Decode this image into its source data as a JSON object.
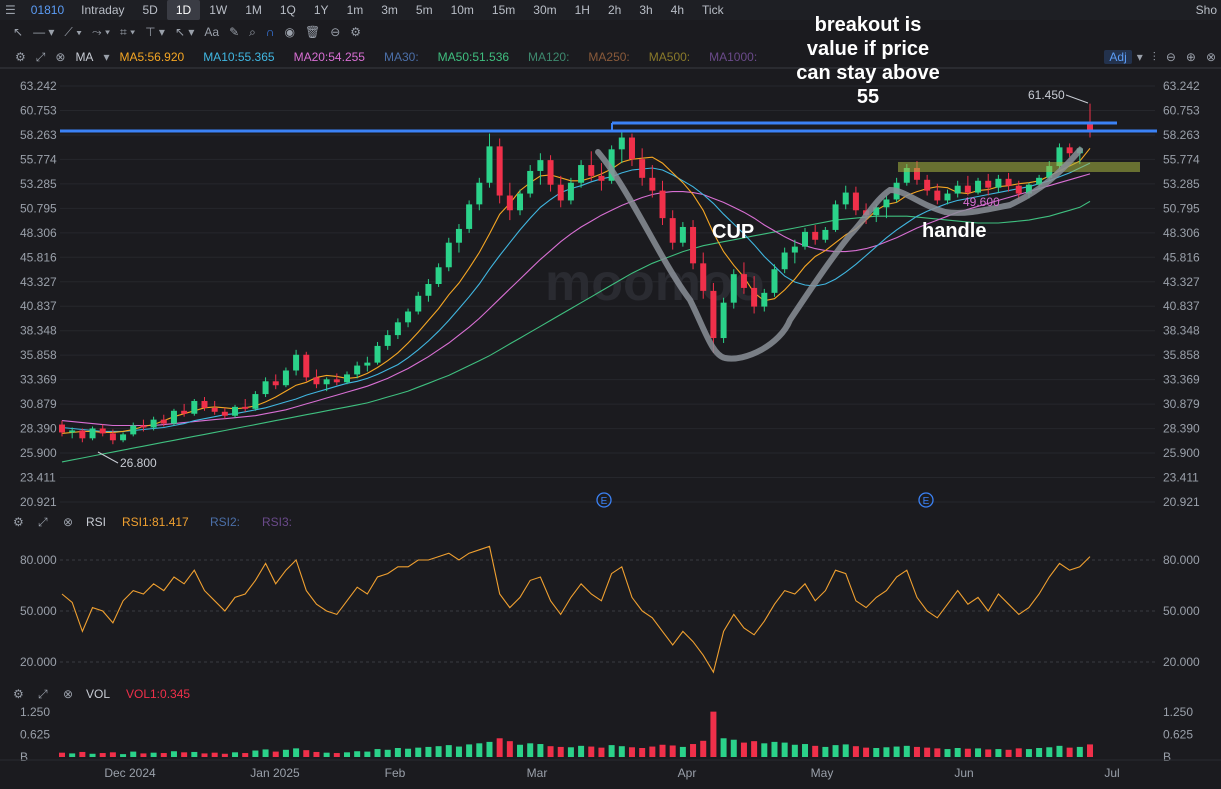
{
  "topbar": {
    "symbol": "01810",
    "timeframes": [
      "Intraday",
      "5D",
      "1D",
      "1W",
      "1M",
      "1Q",
      "1Y",
      "1m",
      "3m",
      "5m",
      "10m",
      "15m",
      "30m",
      "1H",
      "2h",
      "3h",
      "4h",
      "Tick"
    ],
    "active_timeframe": "1D",
    "right_label": "Sho"
  },
  "toolbar": {
    "icons": [
      "cursor-icon",
      "line-icon",
      "trend-icon",
      "path-icon",
      "pattern-icon",
      "measure-icon",
      "arrow-icon",
      "text-icon",
      "pen-icon",
      "zoom-icon",
      "magnet-icon",
      "eye-icon",
      "trash-icon",
      "link-icon",
      "settings-icon"
    ],
    "text_tool": "Aa"
  },
  "ma_bar": {
    "label": "MA",
    "items": [
      {
        "text": "MA5:56.920",
        "color": "#f5a623"
      },
      {
        "text": "MA10:55.365",
        "color": "#40b6e0"
      },
      {
        "text": "MA20:54.255",
        "color": "#d86fd3"
      },
      {
        "text": "MA30:",
        "color": "#4b6fa8"
      },
      {
        "text": "MA50:51.536",
        "color": "#3fbf7f"
      },
      {
        "text": "MA120:",
        "color": "#3e8a6f"
      },
      {
        "text": "MA250:",
        "color": "#8a5a3a"
      },
      {
        "text": "MA500:",
        "color": "#8a7a2a"
      },
      {
        "text": "MA1000:",
        "color": "#6a4a8a"
      }
    ],
    "adj": "Adj"
  },
  "price_axis": {
    "ticks": [
      "63.242",
      "60.753",
      "58.263",
      "55.774",
      "53.285",
      "50.795",
      "48.306",
      "45.816",
      "43.327",
      "40.837",
      "38.348",
      "35.858",
      "33.369",
      "30.879",
      "28.390",
      "25.900",
      "23.411",
      "20.921"
    ]
  },
  "annotations": {
    "breakout": [
      "breakout is",
      "value if price",
      "can stay above",
      "55"
    ],
    "cup": "CUP",
    "handle": "handle",
    "high_label": "61.450",
    "low_label": "26.800",
    "handle_low": "49.600",
    "watermark": "moomoo",
    "event_marker": "E"
  },
  "rsi_bar": {
    "label": "RSI",
    "rsi1": "RSI1:81.417",
    "rsi2": "RSI2:",
    "rsi3": "RSI3:",
    "ticks": [
      "80.000",
      "50.000",
      "20.000"
    ]
  },
  "vol_bar": {
    "label": "VOL",
    "vol1": "VOL1:0.345",
    "ticks": [
      "1.250",
      "0.625",
      "B"
    ],
    "unit": "B"
  },
  "date_axis": [
    "Dec 2024",
    "Jan 2025",
    "Feb",
    "Mar",
    "Apr",
    "May",
    "Jun",
    "Jul"
  ],
  "colors": {
    "up": "#2bd28a",
    "down": "#f0304a",
    "ma5": "#f5a623",
    "ma10": "#40b6e0",
    "ma20": "#d86fd3",
    "ma50": "#3fbf7f",
    "rsi": "#f0a030",
    "level": "#3b82f6"
  },
  "chart_data": {
    "type": "candlestick",
    "ylim": [
      20.921,
      63.242
    ],
    "ohlc": [
      [
        28.8,
        29.2,
        27.6,
        28.0
      ],
      [
        28.0,
        28.5,
        27.4,
        28.2
      ],
      [
        28.2,
        28.4,
        27.0,
        27.4
      ],
      [
        27.4,
        28.6,
        27.2,
        28.4
      ],
      [
        28.4,
        28.8,
        27.6,
        27.9
      ],
      [
        27.9,
        28.3,
        26.8,
        27.2
      ],
      [
        27.2,
        28.0,
        27.0,
        27.8
      ],
      [
        27.8,
        29.0,
        27.6,
        28.7
      ],
      [
        28.7,
        29.3,
        28.1,
        28.5
      ],
      [
        28.5,
        29.6,
        28.2,
        29.3
      ],
      [
        29.3,
        29.8,
        28.6,
        28.9
      ],
      [
        28.9,
        30.4,
        28.7,
        30.2
      ],
      [
        30.2,
        30.9,
        29.6,
        29.9
      ],
      [
        29.9,
        31.4,
        29.7,
        31.2
      ],
      [
        31.2,
        31.6,
        30.2,
        30.5
      ],
      [
        30.5,
        31.2,
        29.8,
        30.1
      ],
      [
        30.1,
        30.5,
        29.4,
        29.7
      ],
      [
        29.7,
        30.8,
        29.5,
        30.6
      ],
      [
        30.6,
        31.4,
        30.1,
        30.4
      ],
      [
        30.4,
        32.2,
        30.2,
        31.9
      ],
      [
        31.9,
        33.6,
        31.6,
        33.2
      ],
      [
        33.2,
        33.9,
        32.4,
        32.8
      ],
      [
        32.8,
        34.6,
        32.6,
        34.3
      ],
      [
        34.3,
        36.4,
        33.8,
        35.9
      ],
      [
        35.9,
        36.2,
        33.2,
        33.6
      ],
      [
        33.6,
        34.4,
        32.5,
        32.9
      ],
      [
        32.9,
        33.6,
        32.2,
        33.4
      ],
      [
        33.4,
        34.0,
        32.8,
        33.1
      ],
      [
        33.1,
        34.2,
        32.9,
        33.9
      ],
      [
        33.9,
        35.2,
        33.5,
        34.8
      ],
      [
        34.8,
        35.7,
        34.2,
        35.1
      ],
      [
        35.1,
        37.2,
        34.9,
        36.8
      ],
      [
        36.8,
        38.4,
        36.4,
        37.9
      ],
      [
        37.9,
        39.6,
        37.5,
        39.2
      ],
      [
        39.2,
        40.6,
        38.7,
        40.3
      ],
      [
        40.3,
        42.3,
        40.0,
        41.9
      ],
      [
        41.9,
        43.6,
        41.3,
        43.1
      ],
      [
        43.1,
        45.2,
        42.8,
        44.8
      ],
      [
        44.8,
        47.8,
        44.4,
        47.3
      ],
      [
        47.3,
        49.2,
        46.3,
        48.7
      ],
      [
        48.7,
        51.6,
        48.3,
        51.2
      ],
      [
        51.2,
        53.9,
        50.6,
        53.4
      ],
      [
        53.4,
        58.4,
        52.9,
        57.1
      ],
      [
        57.1,
        57.9,
        51.3,
        52.1
      ],
      [
        52.1,
        53.4,
        49.6,
        50.6
      ],
      [
        50.6,
        52.7,
        50.1,
        52.3
      ],
      [
        52.3,
        55.2,
        51.9,
        54.6
      ],
      [
        54.6,
        56.4,
        53.2,
        55.7
      ],
      [
        55.7,
        56.2,
        52.5,
        53.2
      ],
      [
        53.2,
        54.1,
        50.9,
        51.6
      ],
      [
        51.6,
        53.9,
        51.2,
        53.4
      ],
      [
        53.4,
        55.7,
        52.9,
        55.2
      ],
      [
        55.2,
        56.6,
        53.6,
        54.1
      ],
      [
        54.1,
        55.4,
        52.6,
        53.6
      ],
      [
        53.6,
        57.2,
        53.3,
        56.8
      ],
      [
        56.8,
        58.6,
        55.4,
        58.0
      ],
      [
        58.0,
        58.4,
        55.1,
        55.8
      ],
      [
        55.8,
        56.9,
        53.1,
        53.9
      ],
      [
        53.9,
        55.2,
        51.9,
        52.6
      ],
      [
        52.6,
        53.6,
        49.1,
        49.8
      ],
      [
        49.8,
        50.6,
        46.6,
        47.3
      ],
      [
        47.3,
        49.4,
        46.9,
        48.9
      ],
      [
        48.9,
        49.6,
        44.6,
        45.2
      ],
      [
        45.2,
        46.3,
        41.6,
        42.4
      ],
      [
        42.4,
        43.2,
        36.1,
        37.6
      ],
      [
        37.6,
        41.7,
        37.1,
        41.2
      ],
      [
        41.2,
        44.6,
        40.6,
        44.1
      ],
      [
        44.1,
        45.3,
        42.1,
        42.7
      ],
      [
        42.7,
        43.9,
        40.1,
        40.8
      ],
      [
        40.8,
        42.6,
        40.3,
        42.2
      ],
      [
        42.2,
        45.1,
        41.8,
        44.6
      ],
      [
        44.6,
        46.8,
        44.2,
        46.3
      ],
      [
        46.3,
        47.6,
        45.2,
        46.9
      ],
      [
        46.9,
        48.8,
        46.6,
        48.4
      ],
      [
        48.4,
        49.1,
        47.1,
        47.6
      ],
      [
        47.6,
        48.9,
        47.3,
        48.6
      ],
      [
        48.6,
        51.6,
        48.4,
        51.2
      ],
      [
        51.2,
        53.1,
        50.7,
        52.4
      ],
      [
        52.4,
        53.0,
        50.1,
        50.6
      ],
      [
        50.6,
        51.3,
        49.2,
        50.1
      ],
      [
        50.1,
        51.2,
        49.4,
        50.9
      ],
      [
        50.9,
        52.1,
        49.8,
        51.7
      ],
      [
        51.7,
        53.9,
        51.4,
        53.4
      ],
      [
        53.4,
        55.3,
        53.1,
        54.9
      ],
      [
        54.9,
        55.6,
        53.2,
        53.7
      ],
      [
        53.7,
        54.2,
        52.1,
        52.6
      ],
      [
        52.6,
        53.3,
        51.2,
        51.6
      ],
      [
        51.6,
        52.7,
        51.2,
        52.3
      ],
      [
        52.3,
        53.6,
        51.9,
        53.1
      ],
      [
        53.1,
        54.1,
        52.1,
        52.4
      ],
      [
        52.4,
        53.9,
        52.2,
        53.6
      ],
      [
        53.6,
        54.3,
        52.1,
        52.9
      ],
      [
        52.9,
        54.2,
        52.4,
        53.8
      ],
      [
        53.8,
        54.4,
        52.5,
        53.1
      ],
      [
        53.1,
        53.6,
        51.7,
        52.3
      ],
      [
        52.3,
        53.4,
        51.8,
        53.2
      ],
      [
        53.2,
        54.2,
        52.7,
        53.9
      ],
      [
        53.9,
        55.6,
        53.6,
        55.1
      ],
      [
        55.1,
        57.4,
        54.8,
        57.0
      ],
      [
        57.0,
        57.4,
        56.0,
        56.4
      ],
      [
        56.4,
        57.1,
        55.3,
        56.9
      ],
      [
        59.6,
        61.45,
        58.0,
        58.6
      ]
    ],
    "volume": [
      0.12,
      0.1,
      0.14,
      0.09,
      0.11,
      0.13,
      0.08,
      0.15,
      0.1,
      0.12,
      0.11,
      0.16,
      0.13,
      0.14,
      0.1,
      0.12,
      0.09,
      0.13,
      0.11,
      0.18,
      0.21,
      0.15,
      0.2,
      0.24,
      0.19,
      0.14,
      0.12,
      0.11,
      0.13,
      0.16,
      0.15,
      0.22,
      0.2,
      0.25,
      0.23,
      0.26,
      0.28,
      0.3,
      0.33,
      0.29,
      0.35,
      0.38,
      0.42,
      0.52,
      0.44,
      0.34,
      0.38,
      0.36,
      0.3,
      0.28,
      0.27,
      0.31,
      0.29,
      0.26,
      0.33,
      0.3,
      0.27,
      0.25,
      0.29,
      0.34,
      0.32,
      0.28,
      0.36,
      0.45,
      1.26,
      0.52,
      0.48,
      0.4,
      0.44,
      0.38,
      0.42,
      0.4,
      0.34,
      0.36,
      0.31,
      0.28,
      0.33,
      0.35,
      0.3,
      0.26,
      0.25,
      0.27,
      0.29,
      0.31,
      0.28,
      0.26,
      0.24,
      0.22,
      0.25,
      0.23,
      0.24,
      0.21,
      0.22,
      0.2,
      0.24,
      0.22,
      0.25,
      0.27,
      0.31,
      0.26,
      0.28,
      0.35
    ],
    "rsi": [
      60,
      55,
      38,
      52,
      50,
      43,
      56,
      62,
      60,
      66,
      62,
      70,
      66,
      74,
      62,
      56,
      50,
      58,
      60,
      68,
      78,
      66,
      74,
      80,
      62,
      54,
      50,
      48,
      56,
      64,
      60,
      70,
      72,
      76,
      76,
      80,
      80,
      82,
      84,
      80,
      84,
      86,
      88,
      60,
      52,
      58,
      68,
      70,
      56,
      48,
      58,
      66,
      60,
      56,
      72,
      76,
      58,
      50,
      46,
      38,
      30,
      38,
      32,
      24,
      14,
      38,
      48,
      40,
      36,
      44,
      54,
      62,
      60,
      66,
      56,
      62,
      74,
      72,
      56,
      52,
      58,
      62,
      70,
      74,
      58,
      50,
      46,
      54,
      62,
      54,
      58,
      50,
      60,
      54,
      48,
      52,
      60,
      70,
      78,
      74,
      76,
      82
    ],
    "ma5": [
      27.9,
      28.0,
      28.1,
      28.1,
      28.0,
      28.0,
      28.1,
      28.3,
      28.6,
      28.8,
      29.2,
      29.6,
      29.9,
      30.2,
      30.5,
      30.6,
      30.5,
      30.4,
      30.5,
      30.7,
      31.1,
      31.6,
      32.2,
      32.8,
      33.1,
      33.6,
      33.8,
      33.7,
      33.5,
      33.6,
      34.0,
      34.6,
      35.3,
      36.1,
      37.1,
      38.2,
      39.4,
      40.6,
      42.0,
      43.2,
      44.7,
      46.3,
      48.2,
      50.2,
      51.3,
      52.6,
      53.4,
      54.1,
      54.2,
      53.9,
      53.6,
      53.6,
      53.9,
      54.3,
      54.8,
      55.5,
      55.8,
      55.9,
      56.0,
      55.4,
      54.4,
      53.4,
      52.2,
      50.6,
      48.3,
      46.4,
      45.0,
      43.8,
      42.2,
      41.4,
      41.6,
      42.5,
      43.6,
      44.9,
      45.9,
      46.5,
      47.3,
      48.1,
      48.7,
      49.6,
      50.6,
      51.2,
      51.4,
      52.1,
      52.5,
      52.8,
      53.0,
      52.9,
      52.4,
      52.3,
      52.6,
      52.7,
      53.0,
      53.1,
      53.3,
      53.4,
      53.6,
      54.1,
      54.6,
      55.1,
      55.6,
      56.9
    ],
    "ma10": [
      28.5,
      28.4,
      28.3,
      28.2,
      28.1,
      28.1,
      28.1,
      28.2,
      28.3,
      28.4,
      28.5,
      28.7,
      28.9,
      29.2,
      29.4,
      29.6,
      29.8,
      29.9,
      30.1,
      30.3,
      30.5,
      30.8,
      31.1,
      31.4,
      31.8,
      32.1,
      32.4,
      32.7,
      33.0,
      33.2,
      33.5,
      33.9,
      34.4,
      34.9,
      35.6,
      36.4,
      37.3,
      38.3,
      39.4,
      40.6,
      41.8,
      43.1,
      44.6,
      46.0,
      47.3,
      48.6,
      49.8,
      50.9,
      51.7,
      52.4,
      52.8,
      53.1,
      53.5,
      53.8,
      54.0,
      54.4,
      54.7,
      54.8,
      54.9,
      54.7,
      54.2,
      53.6,
      53.0,
      52.2,
      51.3,
      50.2,
      49.2,
      48.2,
      47.1,
      45.9,
      44.9,
      43.9,
      43.3,
      43.0,
      42.9,
      43.1,
      43.6,
      44.3,
      45.1,
      46.0,
      46.9,
      47.8,
      48.6,
      49.3,
      50.0,
      50.5,
      50.9,
      51.3,
      51.6,
      51.8,
      52.0,
      52.2,
      52.4,
      52.6,
      52.8,
      53.0,
      53.3,
      53.6,
      54.0,
      54.4,
      54.9,
      55.4
    ],
    "ma20": [
      29.2,
      29.1,
      29.0,
      28.9,
      28.8,
      28.7,
      28.7,
      28.7,
      28.7,
      28.7,
      28.8,
      28.9,
      29.0,
      29.1,
      29.2,
      29.3,
      29.4,
      29.5,
      29.6,
      29.7,
      29.9,
      30.1,
      30.3,
      30.6,
      30.9,
      31.2,
      31.5,
      31.8,
      32.1,
      32.4,
      32.7,
      33.1,
      33.5,
      34.0,
      34.5,
      35.1,
      35.7,
      36.4,
      37.1,
      37.9,
      38.7,
      39.6,
      40.6,
      41.6,
      42.6,
      43.6,
      44.6,
      45.6,
      46.5,
      47.4,
      48.2,
      48.9,
      49.5,
      50.1,
      50.6,
      51.1,
      51.5,
      51.9,
      52.2,
      52.4,
      52.5,
      52.5,
      52.4,
      52.2,
      51.8,
      51.4,
      50.9,
      50.4,
      49.8,
      49.1,
      48.5,
      47.9,
      47.4,
      47.0,
      46.7,
      46.5,
      46.4,
      46.4,
      46.5,
      46.7,
      47.0,
      47.4,
      47.8,
      48.3,
      48.8,
      49.2,
      49.6,
      50.0,
      50.4,
      50.7,
      51.0,
      51.3,
      51.6,
      51.9,
      52.2,
      52.5,
      52.8,
      53.1,
      53.4,
      53.7,
      54.0,
      54.3
    ],
    "ma50": [
      25.0,
      25.2,
      25.4,
      25.6,
      25.8,
      26.0,
      26.2,
      26.4,
      26.6,
      26.8,
      27.0,
      27.2,
      27.4,
      27.6,
      27.8,
      28.0,
      28.2,
      28.4,
      28.6,
      28.8,
      29.0,
      29.2,
      29.4,
      29.6,
      29.8,
      30.0,
      30.2,
      30.4,
      30.6,
      30.8,
      31.0,
      31.3,
      31.6,
      31.9,
      32.2,
      32.6,
      33.0,
      33.4,
      33.8,
      34.3,
      34.8,
      35.3,
      35.8,
      36.4,
      37.0,
      37.6,
      38.2,
      38.8,
      39.4,
      40.0,
      40.6,
      41.2,
      41.8,
      42.4,
      43.0,
      43.6,
      44.2,
      44.7,
      45.2,
      45.6,
      46.0,
      46.4,
      46.7,
      47.0,
      47.2,
      47.4,
      47.6,
      47.8,
      48.0,
      48.2,
      48.4,
      48.6,
      48.8,
      49.0,
      49.2,
      49.4,
      49.6,
      49.7,
      49.8,
      49.9,
      50.0,
      50.0,
      50.0,
      50.0,
      49.9,
      49.8,
      49.7,
      49.6,
      49.5,
      49.4,
      49.3,
      49.3,
      49.3,
      49.4,
      49.5,
      49.6,
      49.8,
      50.0,
      50.3,
      50.6,
      50.9,
      51.5
    ]
  }
}
